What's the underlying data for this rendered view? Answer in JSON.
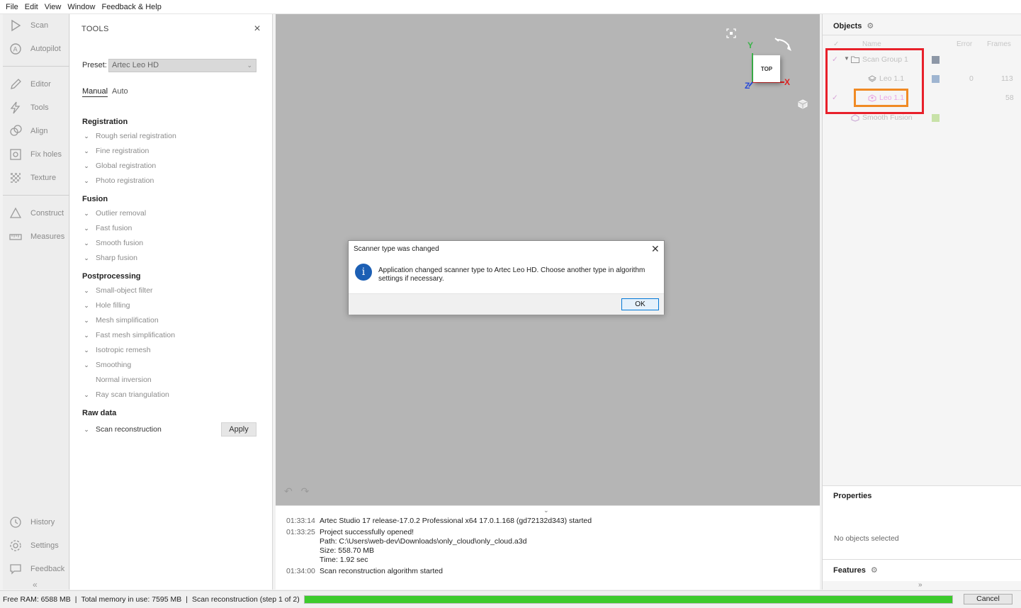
{
  "menu": [
    "File",
    "Edit",
    "View",
    "Window",
    "Feedback & Help"
  ],
  "nav": {
    "items": [
      {
        "label": "Scan",
        "icon": "play-icon"
      },
      {
        "label": "Autopilot",
        "icon": "autopilot-icon"
      },
      {
        "label": "Editor",
        "icon": "pencil-icon"
      },
      {
        "label": "Tools",
        "icon": "lightning-icon"
      },
      {
        "label": "Align",
        "icon": "align-icon"
      },
      {
        "label": "Fix holes",
        "icon": "fix-holes-icon"
      },
      {
        "label": "Texture",
        "icon": "texture-icon"
      },
      {
        "label": "Construct",
        "icon": "triangle-icon"
      },
      {
        "label": "Measures",
        "icon": "ruler-icon"
      }
    ],
    "bottom": [
      {
        "label": "History",
        "icon": "history-icon"
      },
      {
        "label": "Settings",
        "icon": "gear-icon"
      },
      {
        "label": "Feedback",
        "icon": "chat-icon"
      }
    ],
    "collapse": "«"
  },
  "tools": {
    "title": "TOOLS",
    "close": "×",
    "preset_label": "Preset:",
    "preset_value": "Artec Leo HD",
    "tabs": [
      "Manual",
      "Auto"
    ],
    "sections": {
      "registration": {
        "title": "Registration",
        "items": [
          "Rough serial registration",
          "Fine registration",
          "Global registration",
          "Photo registration"
        ]
      },
      "fusion": {
        "title": "Fusion",
        "items": [
          "Outlier removal",
          "Fast fusion",
          "Smooth fusion",
          "Sharp fusion"
        ]
      },
      "postprocessing": {
        "title": "Postprocessing",
        "items": [
          "Small-object filter",
          "Hole filling",
          "Mesh simplification",
          "Fast mesh simplification",
          "Isotropic remesh",
          "Smoothing",
          "Normal inversion",
          "Ray scan triangulation"
        ]
      },
      "rawdata": {
        "title": "Raw data",
        "items": [
          "Scan reconstruction"
        ]
      }
    },
    "apply": "Apply"
  },
  "viewport": {
    "cube_label": "TOP",
    "axes": {
      "x": "X",
      "y": "Y",
      "z": "Z"
    },
    "undo": "↶",
    "redo": "↷"
  },
  "log": {
    "collapse": "⌄",
    "entries": [
      {
        "time": "01:33:14",
        "text": "Artec Studio 17 release-17.0.2 Professional x64 17.0.1.168 (gd72132d343) started"
      },
      {
        "time": "01:33:25",
        "text": "Project successfully opened!"
      },
      {
        "time": "01:34:00",
        "text": "Scan reconstruction algorithm started"
      }
    ],
    "details": [
      "Path: C:\\Users\\web-dev\\Downloads\\only_cloud\\only_cloud.a3d",
      "Size: 558.70 MB",
      "Time: 1.92 sec"
    ]
  },
  "objects": {
    "title": "Objects",
    "columns": {
      "name": "Name",
      "error": "Error",
      "frames": "Frames"
    },
    "rows": [
      {
        "name": "Scan Group 1",
        "error": "",
        "frames": "",
        "color": "#8d97a6"
      },
      {
        "name": "Leo 1.1",
        "error": "0",
        "frames": "113",
        "color": "#9fb5d1"
      },
      {
        "name": "Leo 1.1",
        "error": "",
        "frames": "58",
        "color": ""
      },
      {
        "name": "Smooth Fusion",
        "error": "",
        "frames": "",
        "color": "#c8e2a8"
      }
    ]
  },
  "properties": {
    "title": "Properties",
    "empty": "No objects selected"
  },
  "features": {
    "title": "Features",
    "expand": "»"
  },
  "dialog": {
    "title": "Scanner type was changed",
    "close": "✕",
    "icon": "i",
    "message": "Application changed scanner type to Artec Leo HD. Choose another type in algorithm settings if necessary.",
    "ok": "OK"
  },
  "status": {
    "free_ram": "Free RAM: 6588 MB",
    "sep1": "|",
    "total_memory": "Total memory in use: 7595 MB",
    "sep2": "|",
    "task": "Scan reconstruction (step 1 of 2)",
    "progress": 1.0,
    "cancel": "Cancel"
  }
}
